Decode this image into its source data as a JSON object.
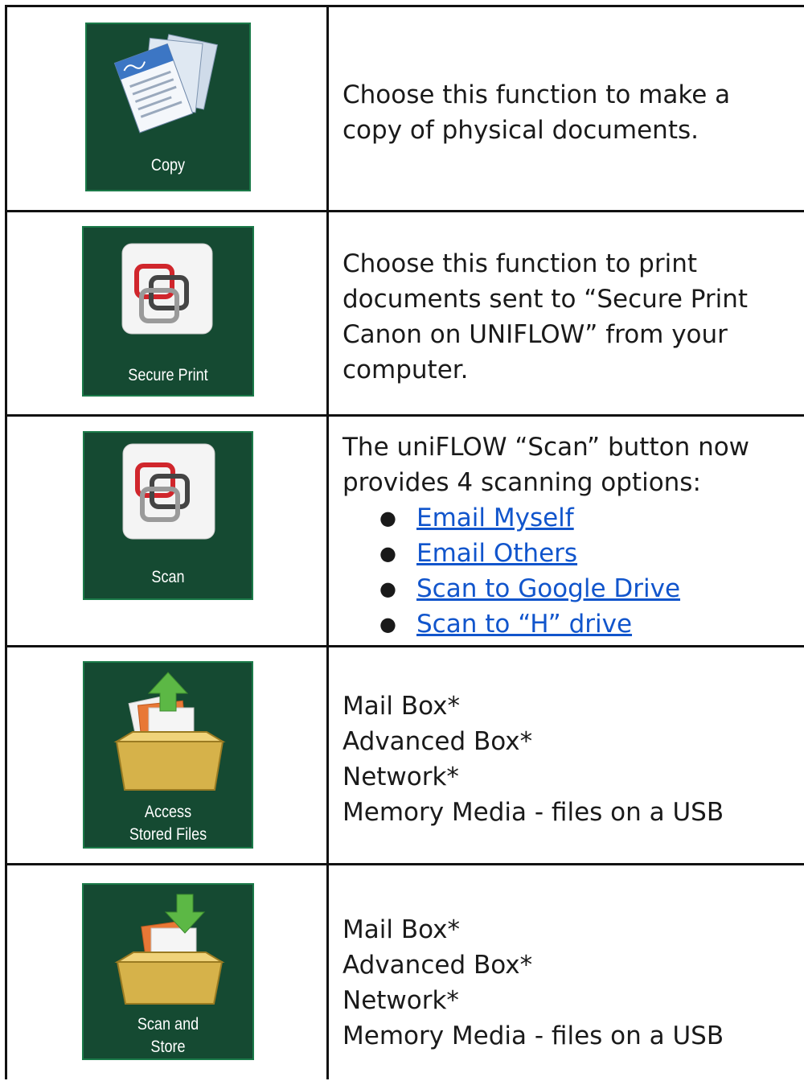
{
  "rows": [
    {
      "tile_label": [
        "Copy"
      ],
      "icon": "copy-documents-icon",
      "description": "Choose this function to make a copy of physical documents."
    },
    {
      "tile_label": [
        "Secure Print"
      ],
      "icon": "secure-print-icon",
      "description": "Choose this function to print documents sent to “Secure Print Canon on UNIFLOW” from your computer."
    },
    {
      "tile_label": [
        "Scan"
      ],
      "icon": "uniflow-scan-icon",
      "description": "The uniFLOW “Scan” button now provides 4 scanning options:",
      "options": [
        "Email Myself",
        "Email Others",
        "Scan to Google Drive",
        "Scan to “H” drive"
      ]
    },
    {
      "tile_label": [
        "Access",
        "Stored Files"
      ],
      "icon": "access-stored-files-icon",
      "lines": [
        "Mail Box*",
        "Advanced Box*",
        "Network*",
        "Memory Media - files on a USB"
      ]
    },
    {
      "tile_label": [
        "Scan and",
        "Store"
      ],
      "icon": "scan-and-store-icon",
      "lines": [
        "Mail Box*",
        "Advanced Box*",
        "Network*",
        "Memory Media - files on a USB"
      ]
    }
  ],
  "colors": {
    "tile_bg": "#154a32",
    "link": "#1155cc",
    "border": "#111111"
  }
}
